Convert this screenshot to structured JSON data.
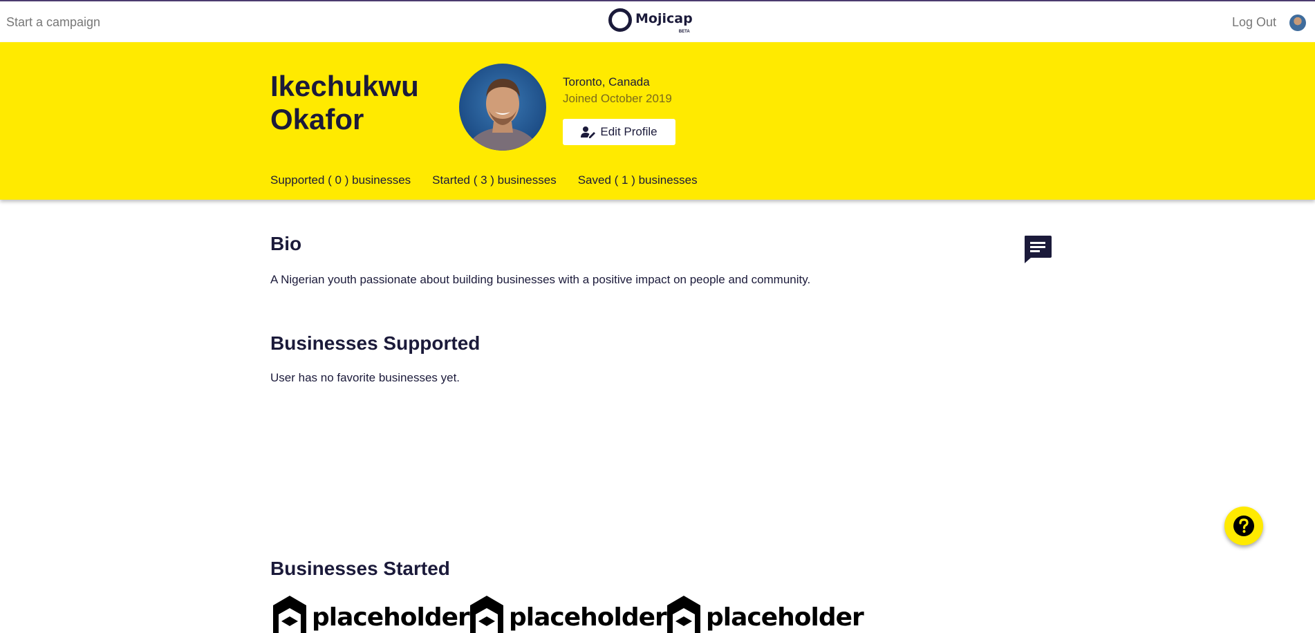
{
  "nav": {
    "start_campaign": "Start a campaign",
    "logo_text": "Mojicap",
    "logo_badge": "BETA",
    "logout": "Log Out"
  },
  "profile": {
    "name": "Ikechukwu Okafor",
    "location": "Toronto, Canada",
    "joined": "Joined October 2019",
    "edit_label": "Edit Profile",
    "tabs": [
      {
        "label": "Supported ( 0 ) businesses"
      },
      {
        "label": "Started ( 3 ) businesses"
      },
      {
        "label": "Saved ( 1 ) businesses"
      }
    ]
  },
  "bio": {
    "title": "Bio",
    "text": "A Nigerian youth passionate about building businesses with a positive impact on people and community."
  },
  "supported": {
    "title": "Businesses Supported",
    "empty_text": "User has no favorite businesses yet."
  },
  "started": {
    "title": "Businesses Started",
    "logos": [
      {
        "label": "placeholder"
      },
      {
        "label": "placeholder"
      },
      {
        "label": "placeholder"
      }
    ]
  },
  "icons": {
    "chat": "chat-icon",
    "help": "help-icon",
    "edit_user": "user-edit-icon"
  },
  "colors": {
    "brand_yellow": "#ffea00",
    "brand_navy": "#1b1a3a"
  }
}
